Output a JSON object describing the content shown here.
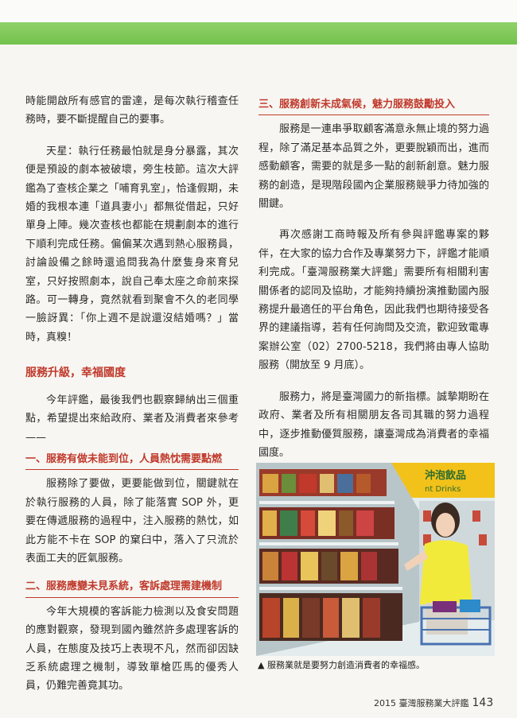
{
  "left_column": {
    "p1": "時能開啟所有感官的雷達，是每次執行稽查任務時，要不斷提醒自己的要事。",
    "p2": "天星：執行任務最怕就是身分暴露，其次便是預設的劇本被破壞，旁生枝節。這次大評鑑為了查核企業之「哺育乳室」，恰逢假期，未婚的我根本連「道具妻小」都無從借起，只好單身上陣。幾次查核也都能在規劃劇本的進行下順利完成任務。偏偏某次遇到熱心服務員，討論設備之餘時還追問我為什麼隻身來育兒室，只好按照劇本，說自己奉太座之命前來探路。可一轉身，竟然就看到聚會不久的老同學一臉訝異：「你上週不是說還沒結婚嗎？」當時，真糗！",
    "heading": "服務升級，幸福國度",
    "p3": "今年評鑑，最後我們也觀察歸納出三個重點，希望提出來給政府、業者及消費者來參考——",
    "sub1": "一、服務有做未能到位，人員熱忱需要點燃",
    "p4": "服務除了要做，更要能做到位，關鍵就在於執行服務的人員，除了能落實 SOP 外，更要在傳遞服務的過程中，注入服務的熱忱，如此方能不卡在 SOP 的窠臼中，落入了只流於表面工夫的匠氣服務。",
    "sub2": "二、服務應變未見系統，客訴處理需建機制",
    "p5": "今年大規模的客訴能力檢測以及食安問題的應對觀察，發現到國內雖然許多處理客訴的人員，在態度及技巧上表現不凡，然而卻因缺乏系統處理之機制，導致單槍匹馬的優秀人員，仍難完善竟其功。"
  },
  "right_column": {
    "sub3": "三、服務創新未成氣候，魅力服務鼓勵投入",
    "p6": "服務是一連串爭取顧客滿意永無止境的努力過程，除了滿足基本品質之外，更要脫穎而出，進而感動顧客，需要的就是多一點的創新創意。魅力服務的創造，是現階段國內企業服務競爭力待加強的關鍵。",
    "p7": "再次感謝工商時報及所有參與評鑑專案的夥伴，在大家的協力合作及專業努力下，評鑑才能順利完成。「臺灣服務業大評鑑」需要所有相關利害關係者的認同及協助，才能夠持續扮演推動國內服務提升最適任的平台角色，因此我們也期待接受各界的建議指導，若有任何詢問及交流，歡迎致電專案辦公室（02）2700-5218，我們將由專人協助服務（開放至 9 月底）。",
    "p8": "服務力，將是臺灣國力的新指標。誠摯期盼在政府、業者及所有相關朋友各司其職的努力過程中，逐步推動優質服務，讓臺灣成為消費者的幸福國度。"
  },
  "photo": {
    "sign_text": "沖泡飲品",
    "sign_subtext": "nt Drinks",
    "caption": "▲ 服務業就是要努力創造消費者的幸福感。"
  },
  "footer": {
    "publication": "2015 臺灣服務業大評鑑",
    "page_number": "143"
  },
  "colors": {
    "accent_green": "#7cc655",
    "heading_red": "#c0392b"
  }
}
